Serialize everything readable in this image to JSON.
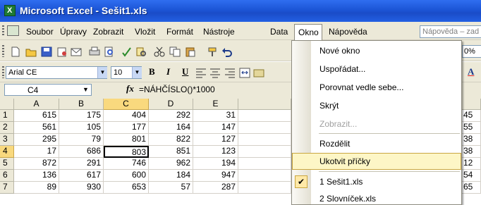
{
  "window": {
    "title": "Microsoft Excel - Sešit1.xls",
    "app_icon_letter": "X"
  },
  "menu": {
    "items": [
      {
        "label": "Soubor"
      },
      {
        "label": "Úpravy"
      },
      {
        "label": "Zobrazit"
      },
      {
        "label": "Vložit"
      },
      {
        "label": "Formát"
      },
      {
        "label": "Nástroje"
      },
      {
        "label": "Data"
      },
      {
        "label": "Okno"
      },
      {
        "label": "Nápověda"
      }
    ],
    "help_placeholder": "Nápověda – zad"
  },
  "toolbar": {
    "zoom_partial": "0%",
    "font_name": "Arial CE",
    "font_size": "10",
    "bold": "B",
    "italic": "I",
    "underline": "U",
    "font_color_letter": "A"
  },
  "formula_bar": {
    "name_box": "C4",
    "fx_label": "fx",
    "formula": "=NÁHČÍSLO()*1000"
  },
  "grid": {
    "columns": [
      "A",
      "B",
      "C",
      "D",
      "E"
    ],
    "rows": [
      {
        "num": "1",
        "values": [
          "615",
          "175",
          "404",
          "292",
          "31"
        ],
        "right": "45"
      },
      {
        "num": "2",
        "values": [
          "561",
          "105",
          "177",
          "164",
          "147"
        ],
        "right": "55"
      },
      {
        "num": "3",
        "values": [
          "295",
          "79",
          "801",
          "822",
          "127"
        ],
        "right": "38"
      },
      {
        "num": "4",
        "values": [
          "17",
          "686",
          "803",
          "851",
          "123"
        ],
        "right": "38"
      },
      {
        "num": "5",
        "values": [
          "872",
          "291",
          "746",
          "962",
          "194"
        ],
        "right": "12"
      },
      {
        "num": "6",
        "values": [
          "136",
          "617",
          "600",
          "184",
          "947"
        ],
        "right": "54"
      },
      {
        "num": "7",
        "values": [
          "89",
          "930",
          "653",
          "57",
          "287"
        ],
        "right": "65"
      }
    ],
    "selected_row": "4",
    "selected_column": "C"
  },
  "dropdown": {
    "items": [
      {
        "label": "Nové okno"
      },
      {
        "label": "Uspořádat..."
      },
      {
        "label": "Porovnat vedle sebe..."
      },
      {
        "label": "Skrýt"
      },
      {
        "label": "Zobrazit..."
      },
      {
        "label": "Rozdělit"
      },
      {
        "label": "Ukotvit příčky"
      },
      {
        "label": "1 Sešit1.xls"
      },
      {
        "label": "2 Slovníček.xls"
      }
    ]
  }
}
